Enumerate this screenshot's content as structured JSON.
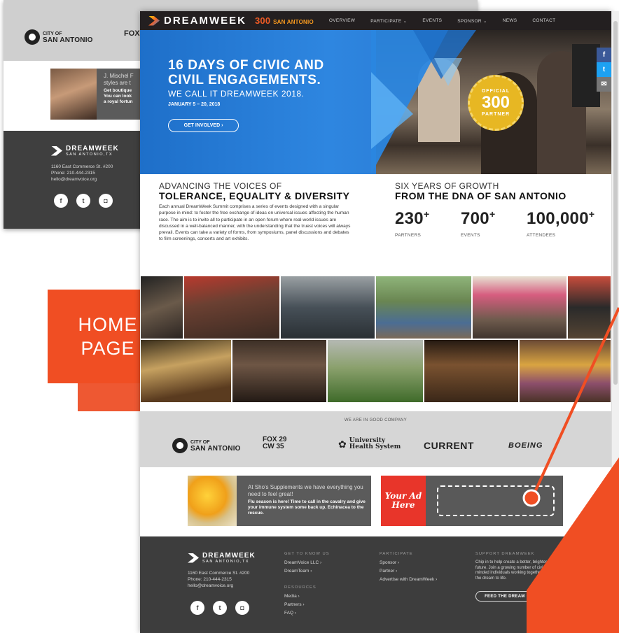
{
  "bg_page": {
    "logo1_line1": "CITY OF",
    "logo1_line2": "SAN ANTONIO",
    "logo2": "FOX",
    "ad_text": "J. Mischel F\nstyles are t",
    "ad_bold": "Get boutique\nYou can look\na royal fortun",
    "footer_brand": "DREAMWEEK",
    "footer_brand_sub": "SAN ANTONIO,TX",
    "address": "1160 East Commerce St. #200",
    "phone": "Phone: 210-444-2315",
    "email": "hello@dreamvoice.org"
  },
  "label": {
    "line1": "HOME",
    "line2": "PAGE"
  },
  "nav": {
    "brand": "DREAMWEEK",
    "sa_num": "300",
    "sa_text": "SAN ANTONIO",
    "items": [
      "OVERVIEW",
      "PARTICIPATE ⌄",
      "EVENTS",
      "SPONSOR ⌄",
      "NEWS",
      "CONTACT"
    ]
  },
  "hero": {
    "title_line1": "16 DAYS OF CIVIC AND",
    "title_line2": "CIVIL ENGAGEMENTS.",
    "subtitle": "WE CALL IT DREAMWEEK 2018.",
    "dates": "JANUARY 5 – 20, 2018",
    "button": "GET INVOLVED ›",
    "badge_top": "OFFICIAL",
    "badge_num": "300",
    "badge_bottom": "PARTNER"
  },
  "share": [
    "f",
    "t",
    "✉"
  ],
  "share_colors": {
    "facebook": "#3b5998",
    "twitter": "#1da1f2",
    "email": "#777777"
  },
  "about": {
    "small": "ADVANCING THE VOICES OF",
    "bold": "TOLERANCE, EQUALITY & DIVERSITY",
    "body": "Each annual DreamWeek Summit comprises a series of events designed with a singular purpose in mind: to foster the free exchange of ideas on universal issues affecting the human race. The aim is to invite all to participate in an open forum where real-world issues are discussed in a well-balanced manner, with the understanding that the truest voices will always prevail. Events can take a variety of forms, from symposiums, panel discussions and debates to film screenings, concerts and art exhibits."
  },
  "growth": {
    "small": "SIX YEARS OF GROWTH",
    "bold": "FROM THE DNA OF SAN ANTONIO",
    "stats": [
      {
        "value": "230",
        "label": "PARTNERS"
      },
      {
        "value": "700",
        "label": "EVENTS"
      },
      {
        "value": "100,000",
        "label": "ATTENDEES"
      }
    ],
    "plus": "+"
  },
  "partners": {
    "heading": "WE ARE IN GOOD COMPANY",
    "logos": [
      "CITY OF",
      "SAN ANTONIO",
      "FOX 29",
      "CW 35",
      "University",
      "Health System",
      "CURRENT",
      "BOEING"
    ]
  },
  "ads": {
    "ad1_text": "At Sho's Supplements we have everything you need to feel great!",
    "ad1_bold": "Flu season is here! Time to call in the cavalry and give your immune system some back up. Echinacea to the rescue.",
    "ad2_label": "Your Ad Here"
  },
  "footer": {
    "brand": "DREAMWEEK",
    "brand_sub": "SAN ANTONIO,TX",
    "address": "1160 East Commerce St. #200",
    "phone": "Phone: 210-444-2315",
    "email": "hello@dreamvoice.org",
    "col1_head": "GET TO KNOW US",
    "col1": [
      "DreamVoice LLC ›",
      "DreamTeam ›"
    ],
    "col1b_head": "RESOURCES",
    "col1b": [
      "Media ›",
      "Partners ›",
      "FAQ ›"
    ],
    "col2_head": "PARTICIPATE",
    "col2": [
      "Sponsor ›",
      "Partner ›",
      "Advertise with DreamWeek ›"
    ],
    "col3_head": "SUPPORT DREAMWEEK",
    "col3_text": "Chip in to help create a better, brighter future. Join a growing number of civic-minded individuals working together to bring the dream to life.",
    "feed_button": "FEED THE DREAM ›"
  },
  "colors": {
    "accent": "#f04e23",
    "nav_bg": "#231f20",
    "hero_blue": "#2e86e0",
    "footer_bg": "#3d3d3d",
    "badge_gold": "#e7b723"
  }
}
